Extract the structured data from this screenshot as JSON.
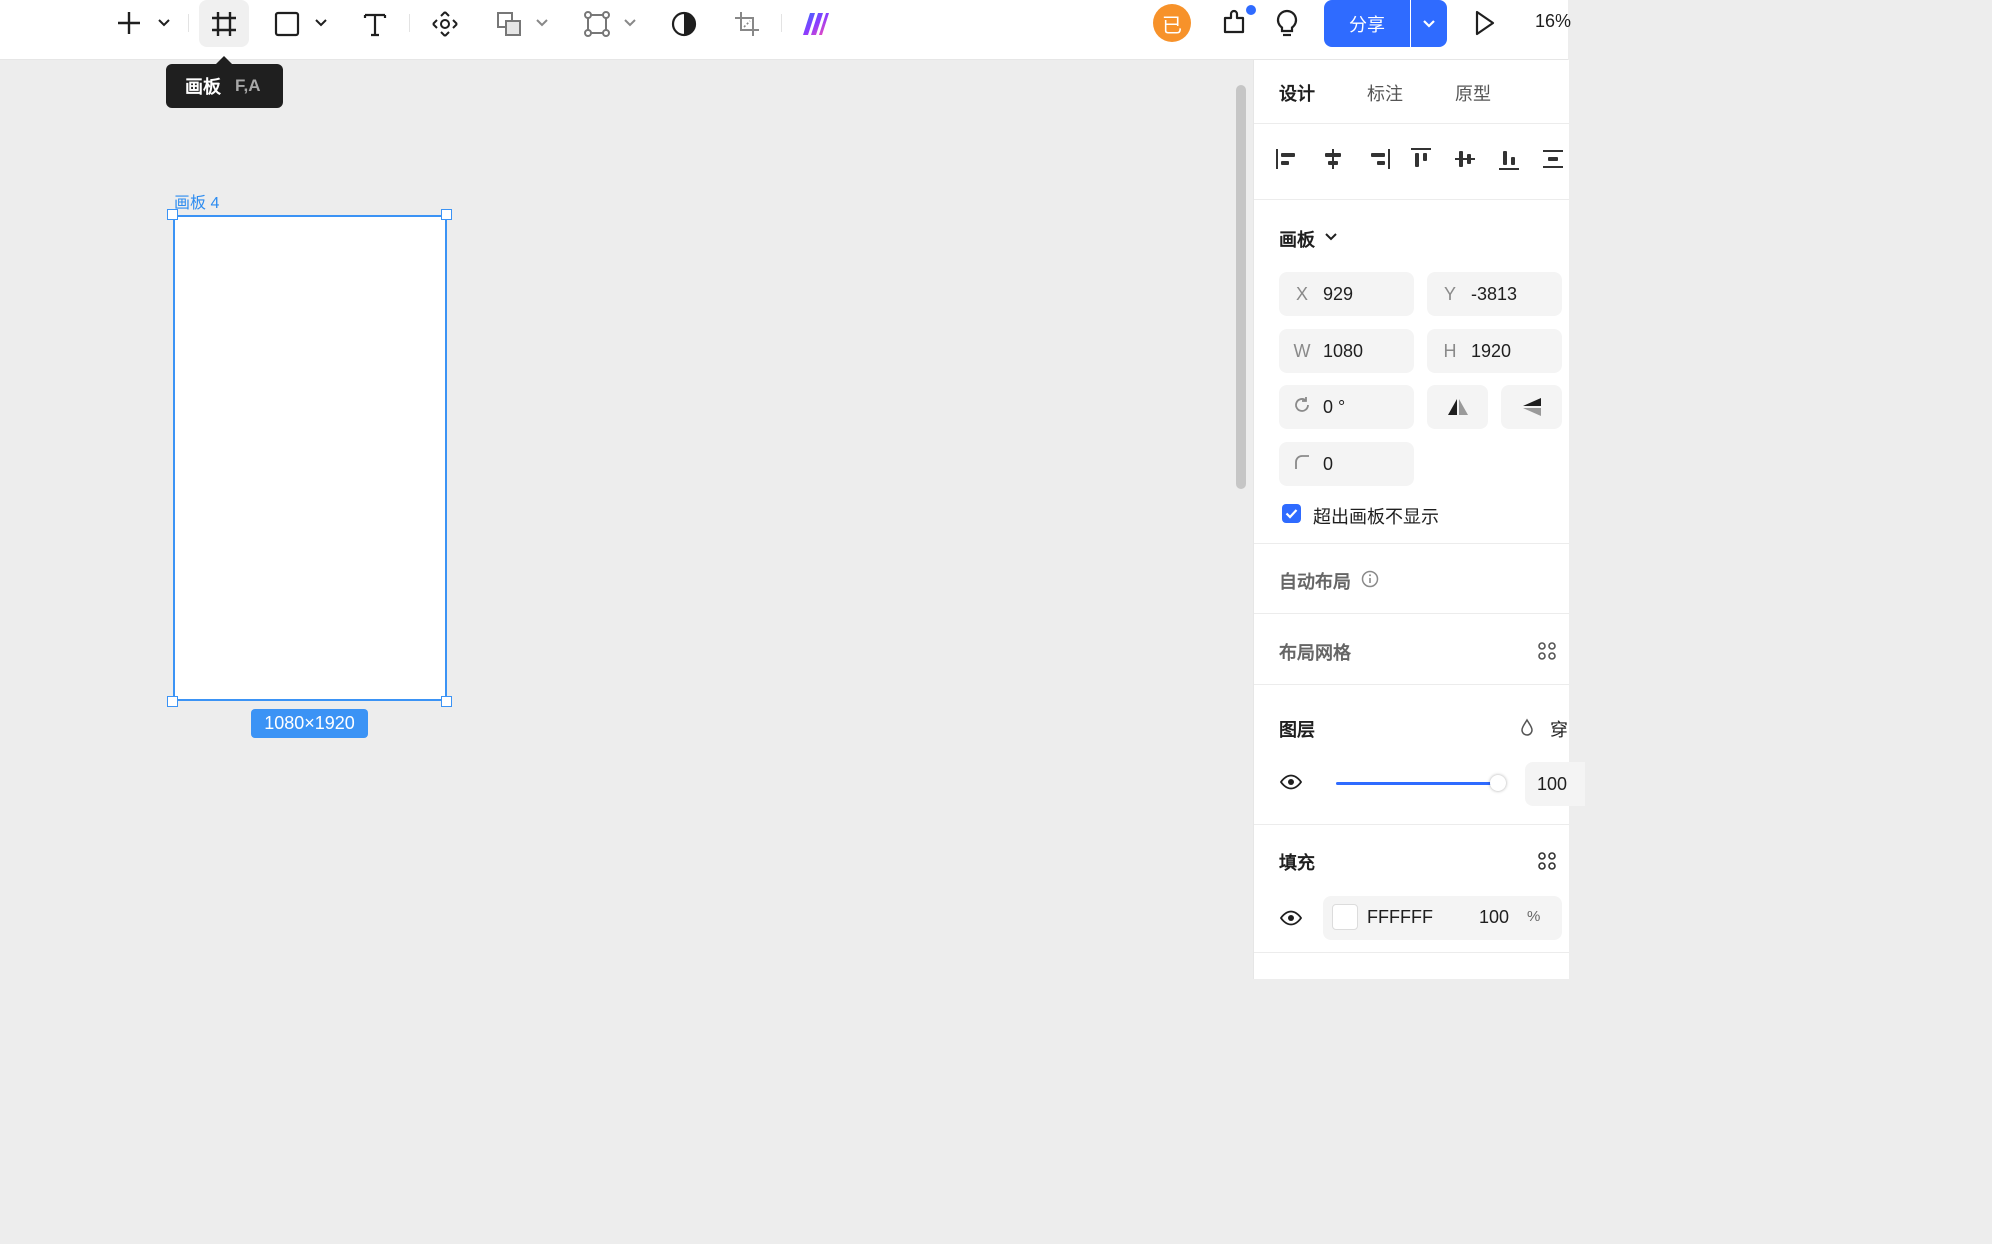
{
  "toolbar": {
    "tools": [
      "add-tool",
      "frame-tool",
      "shape-tool",
      "text-tool",
      "move-tool",
      "boolean-tool",
      "component-tool",
      "mask-tool",
      "crop-tool",
      "ai-tool"
    ],
    "avatar_char": "已",
    "share_label": "分享",
    "zoom": "16%"
  },
  "tooltip": {
    "label": "画板",
    "shortcut": "F,A"
  },
  "canvas": {
    "frame_name": "画板 4",
    "size_badge": "1080×1920",
    "selection_color": "#3b93f5"
  },
  "panel": {
    "tabs": [
      "设计",
      "标注",
      "原型"
    ],
    "active_tab": "设计",
    "frame_section": {
      "title": "画板",
      "x_label": "X",
      "x": "929",
      "y_label": "Y",
      "y": "-3813",
      "w_label": "W",
      "w": "1080",
      "h_label": "H",
      "h": "1920",
      "rotation": "0 °",
      "radius": "0",
      "clip_label": "超出画板不显示",
      "clip_checked": true
    },
    "auto_layout": {
      "title": "自动布局"
    },
    "layout_grid": {
      "title": "布局网格"
    },
    "layer": {
      "title": "图层",
      "blend_label": "穿",
      "opacity": "100",
      "opacity_level": 1.0
    },
    "fill": {
      "title": "填充",
      "hex": "FFFFFF",
      "opacity": "100",
      "unit": "%"
    }
  },
  "colors": {
    "accent": "#2f6bff",
    "avatar": "#f7922a"
  }
}
